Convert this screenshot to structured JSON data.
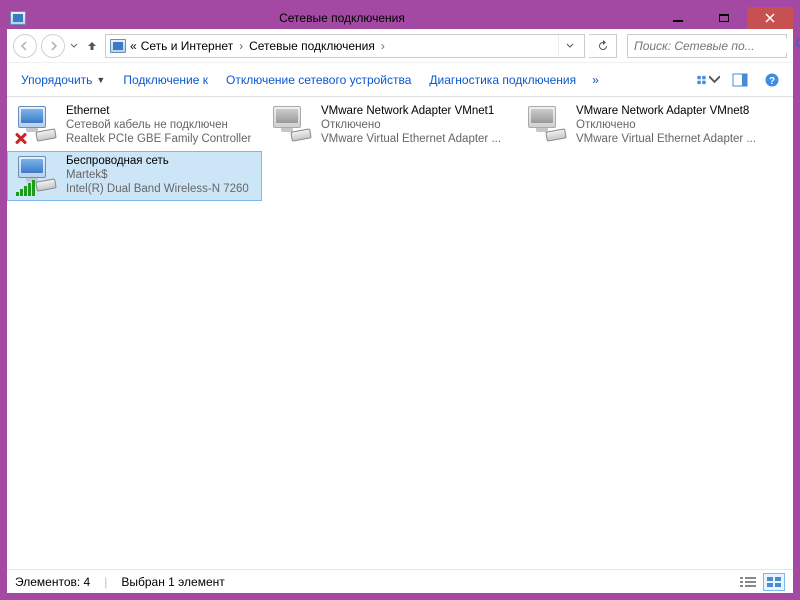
{
  "window": {
    "title": "Сетевые подключения"
  },
  "breadcrumb": {
    "root_prefix": "«",
    "items": [
      "Сеть и Интернет",
      "Сетевые подключения"
    ]
  },
  "search": {
    "placeholder": "Поиск: Сетевые по..."
  },
  "toolbar": {
    "organize": "Упорядочить",
    "connect": "Подключение к",
    "disable": "Отключение сетевого устройства",
    "diagnose": "Диагностика подключения"
  },
  "connections": [
    {
      "name": "Ethernet",
      "status": "Сетевой кабель не подключен",
      "device": "Realtek PCIe GBE Family Controller",
      "state": "unplugged",
      "selected": false
    },
    {
      "name": "VMware Network Adapter VMnet1",
      "status": "Отключено",
      "device": "VMware Virtual Ethernet Adapter ...",
      "state": "disabled",
      "selected": false
    },
    {
      "name": "VMware Network Adapter VMnet8",
      "status": "Отключено",
      "device": "VMware Virtual Ethernet Adapter ...",
      "state": "disabled",
      "selected": false
    },
    {
      "name": "Беспроводная сеть",
      "status": "Martek$",
      "device": "Intel(R) Dual Band Wireless-N 7260",
      "state": "wifi",
      "selected": true
    }
  ],
  "statusbar": {
    "count_label": "Элементов: 4",
    "selection_label": "Выбран 1 элемент"
  }
}
